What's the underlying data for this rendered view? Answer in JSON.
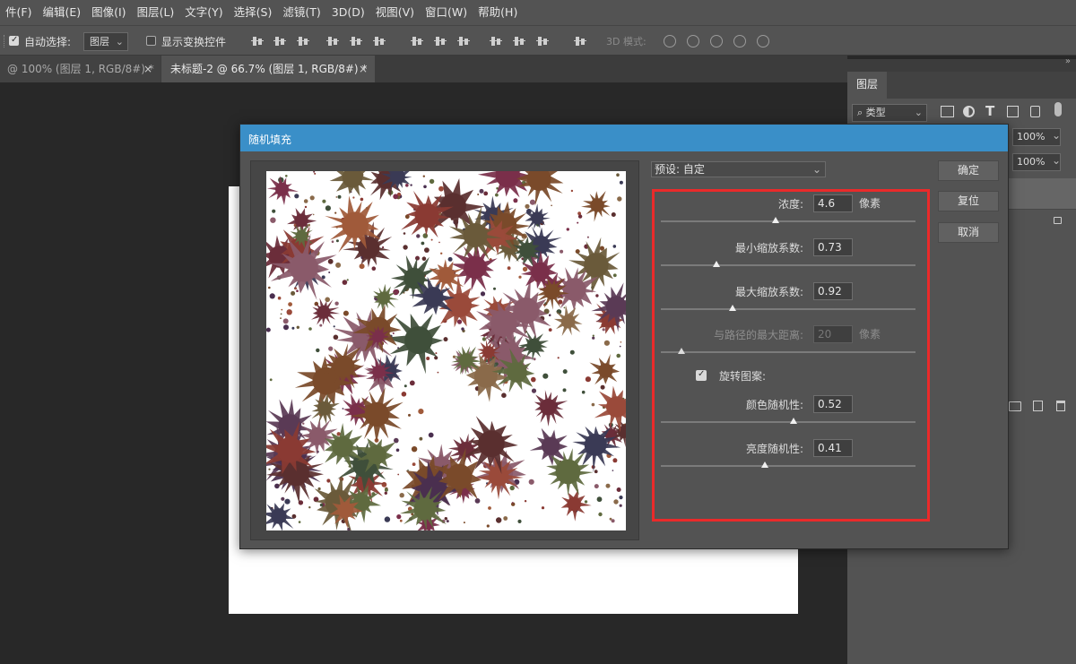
{
  "menu": [
    "件(F)",
    "编辑(E)",
    "图像(I)",
    "图层(L)",
    "文字(Y)",
    "选择(S)",
    "滤镜(T)",
    "3D(D)",
    "视图(V)",
    "窗口(W)",
    "帮助(H)"
  ],
  "options": {
    "auto_select_label": "自动选择:",
    "auto_select_value": "图层",
    "show_transform_label": "显示变换控件",
    "mode_3d_label": "3D 模式:"
  },
  "tabs": [
    {
      "label": "@ 100% (图层 1, RGB/8#) *",
      "close": "×"
    },
    {
      "label": "未标题-2 @ 66.7% (图层 1, RGB/8#) *",
      "close": "×"
    }
  ],
  "layers_panel": {
    "title": "图层",
    "filter_value": "类型",
    "opacity_value": "100%",
    "fill_value": "100%"
  },
  "dialog": {
    "title": "随机填充",
    "preset_label": "预设: 自定",
    "buttons": {
      "ok": "确定",
      "reset": "复位",
      "cancel": "取消"
    },
    "params": [
      {
        "label": "浓度:",
        "value": "4.6",
        "unit": "像素",
        "slider": 0.45,
        "enabled": true
      },
      {
        "label": "最小缩放系数:",
        "value": "0.73",
        "unit": "",
        "slider": 0.22,
        "enabled": true
      },
      {
        "label": "最大缩放系数:",
        "value": "0.92",
        "unit": "",
        "slider": 0.28,
        "enabled": true
      },
      {
        "label": "与路径的最大距离:",
        "value": "20",
        "unit": "像素",
        "slider": 0.08,
        "enabled": false
      },
      {
        "label": "颜色随机性:",
        "value": "0.52",
        "unit": "",
        "slider": 0.52,
        "enabled": true
      },
      {
        "label": "亮度随机性:",
        "value": "0.41",
        "unit": "",
        "slider": 0.41,
        "enabled": true
      }
    ],
    "rotate_label": "旋转图案:",
    "rotate_checked": true
  },
  "colors": {
    "menu_bg": "#535353",
    "dialog_title": "#3a8fc8",
    "highlight_box": "#ea2a2a"
  }
}
